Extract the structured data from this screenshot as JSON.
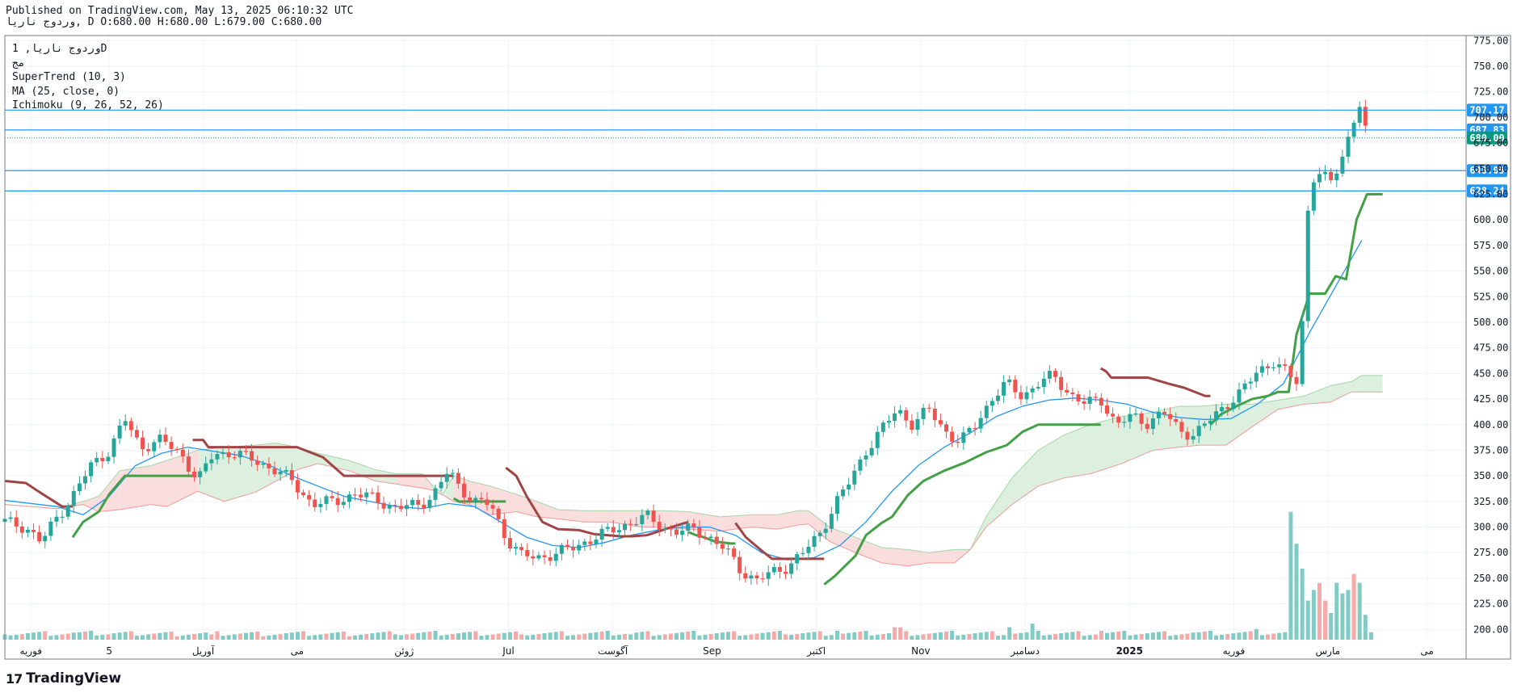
{
  "header": {
    "published_line": "Published on TradingView.com, May 13, 2025 06:10:32 UTC",
    "ohlc_line": "وردوج  ناریا, D O:680.00 H:680.00 L:679.00 C:680.00"
  },
  "legend": {
    "symbol_line": "وردوج  ناریا, 1D",
    "sub_line": "مج",
    "indicators": [
      "SuperTrend (10, 3)",
      "MA (25, close, 0)",
      "Ichimoku (9, 26, 52, 26)"
    ]
  },
  "logo": {
    "mark": "17",
    "text": "TradingView"
  },
  "colors": {
    "up": "#26a69a",
    "down": "#ef5350",
    "ma": "#2196f3",
    "supertrend_up": "#43a047",
    "supertrend_down": "#a04545",
    "cloud_bull": "#cfe9d1",
    "cloud_bear": "#f8cfcf",
    "hline": "#2196f3",
    "last_price": "#089981"
  },
  "chart_data": {
    "type": "candlestick",
    "symbol": "وردوج  ناریا",
    "interval": "1D",
    "ylim": [
      190,
      780
    ],
    "y_ticks": [
      200,
      225,
      250,
      275,
      300,
      325,
      350,
      375,
      400,
      425,
      450,
      475,
      500,
      525,
      550,
      575,
      600,
      625,
      650,
      675,
      700,
      725,
      750,
      775
    ],
    "x_ticks": [
      "فوریه",
      "5",
      "آوریل",
      "می",
      "ژوئن",
      "Jul",
      "آگوست",
      "Sep",
      "اکتبر",
      "Nov",
      "دسامبر",
      "2025",
      "فوریه",
      "مارس",
      "می"
    ],
    "horizontal_lines": [
      707.17,
      687.83,
      648.09,
      628.24
    ],
    "last_price": 680.0,
    "price_path": [
      [
        0,
        305
      ],
      [
        8,
        300
      ],
      [
        14,
        285
      ],
      [
        20,
        310
      ],
      [
        26,
        330
      ],
      [
        33,
        360
      ],
      [
        40,
        375
      ],
      [
        46,
        405
      ],
      [
        52,
        378
      ],
      [
        60,
        385
      ],
      [
        68,
        370
      ],
      [
        74,
        345
      ],
      [
        80,
        372
      ],
      [
        88,
        372
      ],
      [
        96,
        365
      ],
      [
        104,
        355
      ],
      [
        110,
        345
      ],
      [
        118,
        322
      ],
      [
        126,
        325
      ],
      [
        134,
        332
      ],
      [
        142,
        328
      ],
      [
        150,
        318
      ],
      [
        158,
        322
      ],
      [
        164,
        330
      ],
      [
        170,
        355
      ],
      [
        174,
        340
      ],
      [
        180,
        325
      ],
      [
        186,
        322
      ],
      [
        192,
        290
      ],
      [
        198,
        272
      ],
      [
        204,
        270
      ],
      [
        212,
        275
      ],
      [
        218,
        280
      ],
      [
        226,
        290
      ],
      [
        234,
        298
      ],
      [
        240,
        305
      ],
      [
        246,
        310
      ],
      [
        252,
        300
      ],
      [
        258,
        295
      ],
      [
        264,
        298
      ],
      [
        270,
        290
      ],
      [
        276,
        278
      ],
      [
        282,
        258
      ],
      [
        288,
        248
      ],
      [
        294,
        255
      ],
      [
        300,
        262
      ],
      [
        306,
        275
      ],
      [
        312,
        292
      ],
      [
        318,
        322
      ],
      [
        324,
        345
      ],
      [
        330,
        375
      ],
      [
        336,
        395
      ],
      [
        342,
        415
      ],
      [
        348,
        400
      ],
      [
        354,
        415
      ],
      [
        360,
        395
      ],
      [
        366,
        382
      ],
      [
        372,
        400
      ],
      [
        378,
        425
      ],
      [
        384,
        440
      ],
      [
        390,
        428
      ],
      [
        396,
        440
      ],
      [
        402,
        448
      ],
      [
        408,
        430
      ],
      [
        414,
        420
      ],
      [
        420,
        425
      ],
      [
        426,
        400
      ],
      [
        432,
        408
      ],
      [
        438,
        402
      ],
      [
        444,
        412
      ],
      [
        450,
        395
      ],
      [
        456,
        390
      ],
      [
        462,
        405
      ],
      [
        468,
        420
      ],
      [
        474,
        432
      ],
      [
        480,
        452
      ],
      [
        486,
        462
      ],
      [
        492,
        448
      ],
      [
        496,
        440
      ],
      [
        500,
        640
      ],
      [
        504,
        645
      ],
      [
        508,
        635
      ],
      [
        512,
        658
      ],
      [
        516,
        690
      ],
      [
        519,
        715
      ],
      [
        521,
        690
      ],
      [
        523,
        672
      ]
    ],
    "volume": [
      {
        "x": 0,
        "v": 3,
        "up": true
      },
      {
        "x": 26,
        "v": 4,
        "up": true
      },
      {
        "x": 40,
        "v": 3,
        "up": false
      },
      {
        "x": 80,
        "v": 3,
        "up": false
      },
      {
        "x": 150,
        "v": 3,
        "up": true
      },
      {
        "x": 198,
        "v": 3,
        "up": false
      },
      {
        "x": 240,
        "v": 3,
        "up": true
      },
      {
        "x": 300,
        "v": 3,
        "up": false
      },
      {
        "x": 318,
        "v": 5,
        "up": true
      },
      {
        "x": 342,
        "v": 7,
        "up": false
      },
      {
        "x": 384,
        "v": 7,
        "up": true
      },
      {
        "x": 394,
        "v": 9,
        "up": true
      },
      {
        "x": 420,
        "v": 5,
        "up": false
      },
      {
        "x": 456,
        "v": 4,
        "up": true
      },
      {
        "x": 480,
        "v": 6,
        "up": true
      },
      {
        "x": 492,
        "v": 72,
        "up": true
      },
      {
        "x": 494,
        "v": 54,
        "up": true
      },
      {
        "x": 496,
        "v": 40,
        "up": true
      },
      {
        "x": 498,
        "v": 32,
        "up": false
      },
      {
        "x": 500,
        "v": 22,
        "up": true
      },
      {
        "x": 502,
        "v": 28,
        "up": true
      },
      {
        "x": 504,
        "v": 32,
        "up": false
      },
      {
        "x": 506,
        "v": 22,
        "up": false
      },
      {
        "x": 508,
        "v": 15,
        "up": true
      },
      {
        "x": 510,
        "v": 32,
        "up": true
      },
      {
        "x": 512,
        "v": 26,
        "up": true
      },
      {
        "x": 514,
        "v": 28,
        "up": true
      },
      {
        "x": 516,
        "v": 37,
        "up": false
      },
      {
        "x": 518,
        "v": 32,
        "up": true
      },
      {
        "x": 520,
        "v": 26,
        "up": false
      },
      {
        "x": 522,
        "v": 14,
        "up": true
      }
    ],
    "ma": [
      [
        0,
        326
      ],
      [
        20,
        320
      ],
      [
        30,
        312
      ],
      [
        40,
        330
      ],
      [
        50,
        360
      ],
      [
        60,
        372
      ],
      [
        70,
        378
      ],
      [
        80,
        374
      ],
      [
        90,
        370
      ],
      [
        100,
        362
      ],
      [
        110,
        350
      ],
      [
        120,
        340
      ],
      [
        130,
        330
      ],
      [
        140,
        325
      ],
      [
        150,
        320
      ],
      [
        160,
        318
      ],
      [
        170,
        323
      ],
      [
        180,
        320
      ],
      [
        190,
        305
      ],
      [
        200,
        290
      ],
      [
        210,
        282
      ],
      [
        220,
        280
      ],
      [
        230,
        285
      ],
      [
        240,
        292
      ],
      [
        250,
        297
      ],
      [
        260,
        300
      ],
      [
        270,
        300
      ],
      [
        280,
        292
      ],
      [
        290,
        275
      ],
      [
        300,
        268
      ],
      [
        310,
        270
      ],
      [
        320,
        282
      ],
      [
        330,
        305
      ],
      [
        340,
        335
      ],
      [
        350,
        360
      ],
      [
        360,
        378
      ],
      [
        370,
        392
      ],
      [
        380,
        408
      ],
      [
        390,
        418
      ],
      [
        400,
        424
      ],
      [
        410,
        426
      ],
      [
        420,
        424
      ],
      [
        430,
        420
      ],
      [
        440,
        412
      ],
      [
        450,
        407
      ],
      [
        460,
        405
      ],
      [
        470,
        406
      ],
      [
        480,
        420
      ],
      [
        490,
        440
      ],
      [
        500,
        490
      ],
      [
        510,
        535
      ],
      [
        520,
        580
      ]
    ],
    "supertrend": [
      {
        "dir": "down",
        "points": [
          [
            0,
            345
          ],
          [
            8,
            343
          ],
          [
            14,
            333
          ],
          [
            22,
            320
          ],
          [
            26,
            320
          ]
        ]
      },
      {
        "dir": "up",
        "points": [
          [
            26,
            290
          ],
          [
            30,
            305
          ],
          [
            36,
            315
          ],
          [
            40,
            332
          ],
          [
            46,
            350
          ],
          [
            70,
            350
          ],
          [
            72,
            350
          ]
        ]
      },
      {
        "dir": "down",
        "points": [
          [
            72,
            385
          ],
          [
            76,
            385
          ],
          [
            78,
            378
          ],
          [
            112,
            378
          ],
          [
            118,
            372
          ],
          [
            122,
            368
          ],
          [
            130,
            350
          ],
          [
            170,
            350
          ],
          [
            172,
            350
          ]
        ]
      },
      {
        "dir": "up",
        "points": [
          [
            172,
            328
          ],
          [
            174,
            325
          ],
          [
            190,
            325
          ],
          [
            192,
            325
          ]
        ]
      },
      {
        "dir": "down",
        "points": [
          [
            192,
            358
          ],
          [
            196,
            350
          ],
          [
            200,
            330
          ],
          [
            206,
            305
          ],
          [
            212,
            298
          ],
          [
            220,
            297
          ],
          [
            226,
            293
          ],
          [
            236,
            291
          ],
          [
            240,
            291
          ],
          [
            246,
            292
          ],
          [
            252,
            297
          ],
          [
            258,
            302
          ],
          [
            262,
            305
          ]
        ]
      },
      {
        "dir": "up",
        "points": [
          [
            262,
            295
          ],
          [
            265,
            292
          ],
          [
            268,
            290
          ],
          [
            272,
            286
          ],
          [
            278,
            284
          ],
          [
            280,
            284
          ]
        ]
      },
      {
        "dir": "down",
        "points": [
          [
            280,
            304
          ],
          [
            284,
            290
          ],
          [
            290,
            277
          ],
          [
            294,
            269
          ],
          [
            310,
            269
          ],
          [
            314,
            269
          ]
        ]
      },
      {
        "dir": "up",
        "points": [
          [
            314,
            244
          ],
          [
            318,
            252
          ],
          [
            322,
            262
          ],
          [
            326,
            272
          ],
          [
            330,
            292
          ],
          [
            336,
            304
          ],
          [
            340,
            310
          ],
          [
            346,
            331
          ],
          [
            352,
            345
          ],
          [
            360,
            355
          ],
          [
            368,
            363
          ],
          [
            376,
            373
          ],
          [
            384,
            380
          ],
          [
            390,
            393
          ],
          [
            396,
            400
          ],
          [
            416,
            400
          ],
          [
            420,
            400
          ]
        ]
      },
      {
        "dir": "down",
        "points": [
          [
            420,
            455
          ],
          [
            422,
            452
          ],
          [
            424,
            446
          ],
          [
            438,
            446
          ],
          [
            446,
            440
          ],
          [
            452,
            436
          ],
          [
            460,
            428
          ],
          [
            462,
            428
          ]
        ]
      },
      {
        "dir": "up",
        "points": [
          [
            462,
            400
          ],
          [
            466,
            410
          ],
          [
            472,
            418
          ],
          [
            478,
            425
          ],
          [
            484,
            428
          ],
          [
            488,
            432
          ],
          [
            492,
            432
          ],
          [
            495,
            488
          ],
          [
            500,
            528
          ],
          [
            506,
            528
          ],
          [
            510,
            545
          ],
          [
            514,
            542
          ],
          [
            518,
            600
          ],
          [
            522,
            625
          ],
          [
            528,
            625
          ]
        ]
      }
    ],
    "cloud": [
      [
        0,
        322,
        322
      ],
      [
        10,
        320,
        320
      ],
      [
        20,
        318,
        318
      ],
      [
        30,
        322,
        325
      ],
      [
        36,
        315,
        330
      ],
      [
        44,
        317,
        355
      ],
      [
        56,
        322,
        360
      ],
      [
        62,
        320,
        365
      ],
      [
        74,
        335,
        375
      ],
      [
        84,
        325,
        378
      ],
      [
        96,
        334,
        380
      ],
      [
        104,
        345,
        382
      ],
      [
        112,
        356,
        378
      ],
      [
        120,
        362,
        372
      ],
      [
        132,
        355,
        365
      ],
      [
        142,
        345,
        356
      ],
      [
        150,
        342,
        352
      ],
      [
        160,
        338,
        352
      ],
      [
        164,
        336,
        340
      ],
      [
        168,
        331,
        333
      ],
      [
        172,
        325,
        350
      ],
      [
        178,
        322,
        345
      ],
      [
        186,
        312,
        340
      ],
      [
        196,
        315,
        332
      ],
      [
        204,
        310,
        325
      ],
      [
        212,
        308,
        317
      ],
      [
        222,
        305,
        316
      ],
      [
        232,
        305,
        316
      ],
      [
        244,
        300,
        316
      ],
      [
        252,
        300,
        316
      ],
      [
        262,
        298,
        315
      ],
      [
        274,
        296,
        310
      ],
      [
        286,
        300,
        312
      ],
      [
        296,
        298,
        312
      ],
      [
        304,
        302,
        316
      ],
      [
        308,
        303,
        316
      ],
      [
        316,
        286,
        300
      ],
      [
        326,
        275,
        290
      ],
      [
        336,
        265,
        280
      ],
      [
        346,
        262,
        278
      ],
      [
        354,
        265,
        275
      ],
      [
        364,
        265,
        278
      ],
      [
        370,
        278,
        278
      ],
      [
        376,
        300,
        310
      ],
      [
        386,
        322,
        348
      ],
      [
        396,
        340,
        375
      ],
      [
        406,
        348,
        390
      ],
      [
        416,
        352,
        400
      ],
      [
        428,
        362,
        408
      ],
      [
        440,
        375,
        412
      ],
      [
        450,
        378,
        418
      ],
      [
        458,
        380,
        418
      ],
      [
        468,
        380,
        420
      ],
      [
        478,
        398,
        420
      ],
      [
        488,
        415,
        424
      ],
      [
        498,
        420,
        428
      ],
      [
        508,
        422,
        438
      ],
      [
        516,
        432,
        442
      ],
      [
        520,
        432,
        448
      ],
      [
        528,
        432,
        448
      ]
    ]
  }
}
